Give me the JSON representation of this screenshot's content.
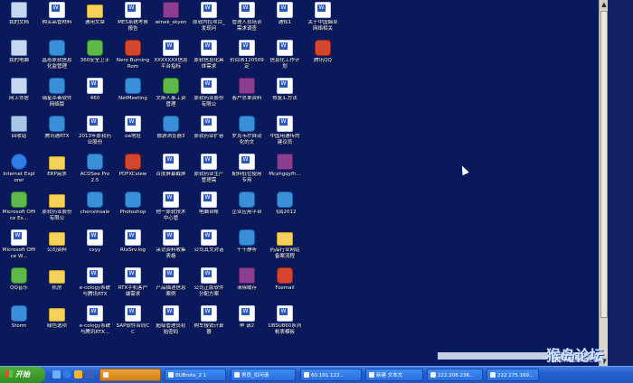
{
  "desktop": {
    "icons": [
      {
        "label": "我的文档",
        "type": "pc"
      },
      {
        "label": "购买高管材料",
        "type": "doc"
      },
      {
        "label": "通用文章",
        "type": "folder"
      },
      {
        "label": "MES系统考察报告",
        "type": "doc"
      },
      {
        "label": "winek_skyen",
        "type": "rar"
      },
      {
        "label": "原软内控项目_发现问",
        "type": "doc"
      },
      {
        "label": "管理人员培训需求调查",
        "type": "doc"
      },
      {
        "label": "通知1",
        "type": "doc"
      },
      {
        "label": "关于中国烟草网络相关",
        "type": "doc"
      },
      {
        "label": "我的电脑",
        "type": "pc"
      },
      {
        "label": "昌邑原软信息化监管理",
        "type": "app"
      },
      {
        "label": "360安全卫士",
        "type": "green"
      },
      {
        "label": "Nero Burning Rom",
        "type": "red"
      },
      {
        "label": "XXXXXXX信息平台指标",
        "type": "doc"
      },
      {
        "label": "原软信息化具体需求",
        "type": "doc"
      },
      {
        "label": "价目表120509定",
        "type": "doc"
      },
      {
        "label": "信息化工作计划",
        "type": "doc"
      },
      {
        "label": "腾讯QQ",
        "type": "red"
      },
      {
        "label": "网上邻居",
        "type": "pc"
      },
      {
        "label": "瑞星杀毒软件网络版",
        "type": "app"
      },
      {
        "label": "460",
        "type": "doc"
      },
      {
        "label": "NetMeeting",
        "type": "app"
      },
      {
        "label": "文斯人事工资管理",
        "type": "green"
      },
      {
        "label": "原软药业股份有限公",
        "type": "doc"
      },
      {
        "label": "客户总单资料",
        "type": "rar"
      },
      {
        "label": "修复汇方法",
        "type": "doc"
      },
      {
        "label": "回收站",
        "type": "bin"
      },
      {
        "label": "腾讯通RTX",
        "type": "app"
      },
      {
        "label": "2013年原软药业股份",
        "type": "doc"
      },
      {
        "label": "oa地址",
        "type": "doc"
      },
      {
        "label": "傲游浏览器3",
        "type": "app"
      },
      {
        "label": "原软药业扩容",
        "type": "doc"
      },
      {
        "label": "罗克韦尔自动化的文",
        "type": "app"
      },
      {
        "label": "中国用通传的建议员",
        "type": "doc"
      },
      {
        "label": "Internet Explorer",
        "type": "ie"
      },
      {
        "label": "ERP需求",
        "type": "folder"
      },
      {
        "label": "ACDSee Pro 2.5",
        "type": "app"
      },
      {
        "label": "PDFXCview",
        "type": "red"
      },
      {
        "label": "百度屏幕截屏",
        "type": "doc"
      },
      {
        "label": "原软药业生产管理需",
        "type": "doc"
      },
      {
        "label": "配料低位使用专用",
        "type": "doc"
      },
      {
        "label": "Mcxhgqyfh...",
        "type": "rar"
      },
      {
        "label": "Microsoft Office Ex...",
        "type": "green"
      },
      {
        "label": "原软药业股份有限公",
        "type": "folder"
      },
      {
        "label": "chenxinsale",
        "type": "app"
      },
      {
        "label": "Photoshop",
        "type": "app"
      },
      {
        "label": "他一原软技术中心管",
        "type": "doc"
      },
      {
        "label": "电脑台帐",
        "type": "doc"
      },
      {
        "label": "企业应用平台",
        "type": "app"
      },
      {
        "label": "飞鸽2012",
        "type": "app"
      },
      {
        "label": "Microsoft Office W...",
        "type": "doc"
      },
      {
        "label": "公司资料",
        "type": "folder"
      },
      {
        "label": "cxyy",
        "type": "doc"
      },
      {
        "label": "RtxSrv.log",
        "type": "doc"
      },
      {
        "label": "采访资料收集表格",
        "type": "doc"
      },
      {
        "label": "公司其文对话",
        "type": "doc"
      },
      {
        "label": "千千静听",
        "type": "app"
      },
      {
        "label": "药品行业网站备案流程",
        "type": "folder"
      },
      {
        "label": "QQ音乐",
        "type": "green"
      },
      {
        "label": "机房",
        "type": "folder"
      },
      {
        "label": "e-cology系统与腾讯RTX",
        "type": "doc"
      },
      {
        "label": "RTX手机客户端需求",
        "type": "doc"
      },
      {
        "label": "产品描述信息案例",
        "type": "doc"
      },
      {
        "label": "公司正版软件分配方案",
        "type": "doc"
      },
      {
        "label": "清除缓存",
        "type": "rar"
      },
      {
        "label": "Foxmail",
        "type": "red"
      },
      {
        "label": "Storm",
        "type": "app"
      },
      {
        "label": "绿色选项",
        "type": "folder"
      },
      {
        "label": "e-cology系统与腾讯RTX...",
        "type": "doc"
      },
      {
        "label": "SAP软件合同CC",
        "type": "doc"
      },
      {
        "label": "超级管理员初始密码",
        "type": "doc"
      },
      {
        "label": "购车报销计算器",
        "type": "doc"
      },
      {
        "label": "申 请2",
        "type": "doc"
      },
      {
        "label": "U8SU860系列帐表模板",
        "type": "doc"
      }
    ],
    "watermark": {
      "brand": "猴岛论坛",
      "site": "BBS.HOUDAO.COM"
    }
  },
  "taskbar": {
    "start_label": "开始",
    "tasks": [
      {
        "label": "",
        "active": true
      },
      {
        "label": "BUBrote_2 1",
        "active": false
      },
      {
        "label": "男员_扣问请",
        "active": false
      },
      {
        "label": "60.191.122...",
        "active": false
      },
      {
        "label": "新建 文本文",
        "active": false
      },
      {
        "label": "222.208.236...",
        "active": false
      },
      {
        "label": "222.175.169...",
        "active": false
      }
    ]
  },
  "colors": {
    "desktop": "#0a195c",
    "taskbar": "#245ed0",
    "start": "#2f8d22"
  }
}
